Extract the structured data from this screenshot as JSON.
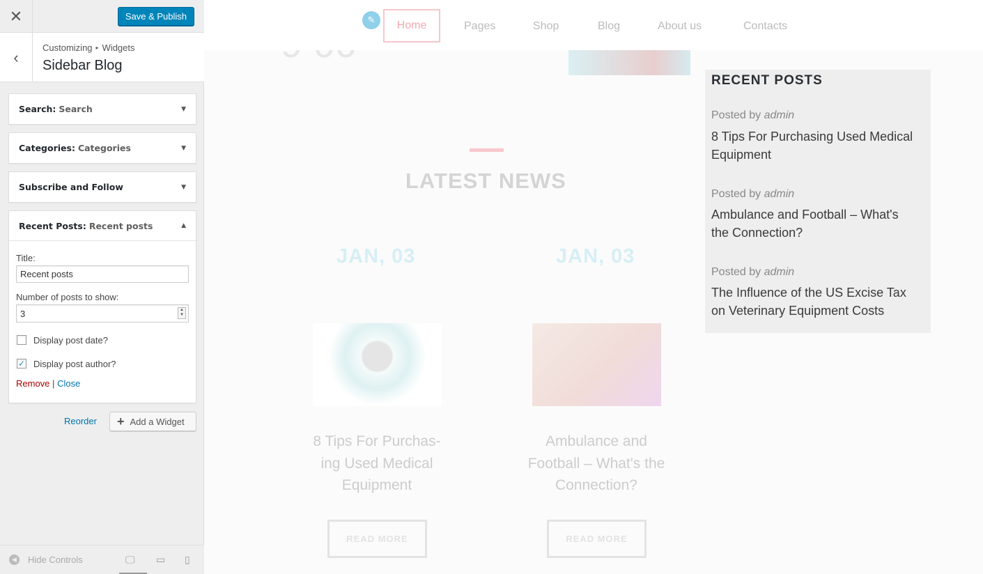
{
  "topbar": {
    "close_icon": "✕",
    "save_label": "Save & Publish",
    "save_color": "#0085ba"
  },
  "section": {
    "back_icon": "‹",
    "breadcrumb": [
      "Customizing",
      "Widgets"
    ],
    "breadcrumb_sep": "▸",
    "title": "Sidebar Blog"
  },
  "widgets": [
    {
      "name": "Search:",
      "sub": "Search",
      "arrow": "▼"
    },
    {
      "name": "Categories:",
      "sub": "Categories",
      "arrow": "▼"
    },
    {
      "name": "Subscribe and Follow",
      "sub": "",
      "arrow": "▼"
    },
    {
      "name": "Recent Posts:",
      "sub": "Recent posts",
      "arrow": "▲"
    }
  ],
  "recent_form": {
    "title_label": "Title:",
    "title_value": "Recent posts",
    "number_label": "Number of posts to show:",
    "number_value": "3",
    "show_date_label": "Display post date?",
    "show_date_checked": false,
    "show_author_label": "Display post author?",
    "show_author_checked": true,
    "remove_label": "Remove",
    "separator": "|",
    "close_label": "Close"
  },
  "actions": {
    "reorder_label": "Reorder",
    "add_widget_label": "Add a Widget",
    "add_icon": "+"
  },
  "footer": {
    "hide_controls_label": "Hide Controls",
    "hide_icon": "◀",
    "devices": [
      "desktop-icon",
      "tablet-icon",
      "mobile-icon"
    ]
  },
  "preview": {
    "nav": [
      "Home",
      "Pages",
      "Shop",
      "Blog",
      "About us",
      "Contacts"
    ],
    "active_nav": "Home",
    "latest_news_title": "LATEST NEWS",
    "posts": [
      {
        "date": "JAN, 03",
        "title": "8 Tips For Purchas-ing Used Medical Equipment",
        "read_more": "READ MORE"
      },
      {
        "date": "JAN, 03",
        "title": "Ambulance and Football – What's the Connection?",
        "read_more": "READ MORE"
      }
    ],
    "recent_widget": {
      "heading": "RECENT POSTS",
      "posted_by": "Posted by",
      "items": [
        {
          "author": "admin",
          "title": "8 Tips For Purchasing Used Medical Equipment"
        },
        {
          "author": "admin",
          "title": "Ambulance and Football – What's the Connection?"
        },
        {
          "author": "admin",
          "title": "The Influence of the US Excise Tax on Veterinary Equipment Costs"
        }
      ]
    },
    "accent_color": "#f4a8b0",
    "date_color": "#d6eff5"
  }
}
